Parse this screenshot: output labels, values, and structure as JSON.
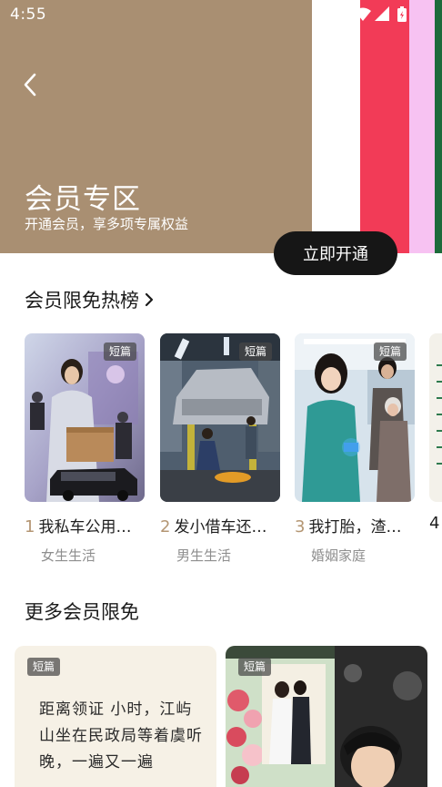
{
  "status_bar": {
    "time": "4:55",
    "icons": [
      "wifi-icon",
      "signal-icon",
      "battery-icon"
    ]
  },
  "header": {
    "title": "会员专区",
    "subtitle": "开通会员，享多项专属权益",
    "activate_label": "立即开通",
    "colors": {
      "banner": "#a98f72",
      "button": "#161616"
    }
  },
  "hot_section": {
    "title": "会员限免热榜",
    "items": [
      {
        "rank": "1",
        "title": "我私车公用…",
        "category": "女生生活",
        "badge": "短篇"
      },
      {
        "rank": "2",
        "title": "发小借车还…",
        "category": "男生生活",
        "badge": "短篇"
      },
      {
        "rank": "3",
        "title": "我打胎，渣…",
        "category": "婚姻家庭",
        "badge": "短篇"
      },
      {
        "rank": "4"
      }
    ],
    "rank_color": "#b49673"
  },
  "more_section": {
    "title": "更多会员限免",
    "cards": [
      {
        "badge": "短篇",
        "excerpt": "距离领证 小时，江屿山坐在民政局等着虞听晚，一遍又一遍"
      },
      {
        "badge": "短篇"
      }
    ]
  }
}
